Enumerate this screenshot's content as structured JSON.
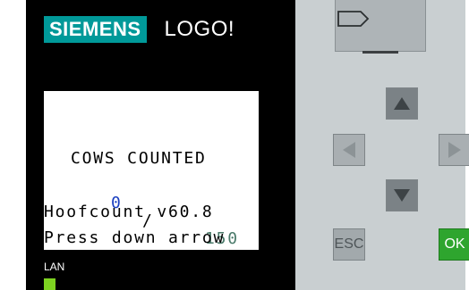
{
  "brand": {
    "maker": "SIEMENS",
    "product": "LOGO!"
  },
  "display": {
    "title": "COWS COUNTED",
    "count_current": "0",
    "count_separator": "/",
    "count_total": "150",
    "version": "Hoofcount v60.8",
    "hint": "Press down arrow"
  },
  "status": {
    "lan_label": "LAN",
    "lan_color": "#7ed321"
  },
  "keypad": {
    "esc_label": "ESC",
    "ok_label": "OK",
    "ok_color": "#2ea52e",
    "up_icon": "arrow-up-icon",
    "down_icon": "arrow-down-icon",
    "left_icon": "arrow-left-icon",
    "right_icon": "arrow-right-icon"
  },
  "colors": {
    "brand_teal": "#009999",
    "count_current": "#1a3fc0",
    "count_total": "#4a7a6a"
  }
}
